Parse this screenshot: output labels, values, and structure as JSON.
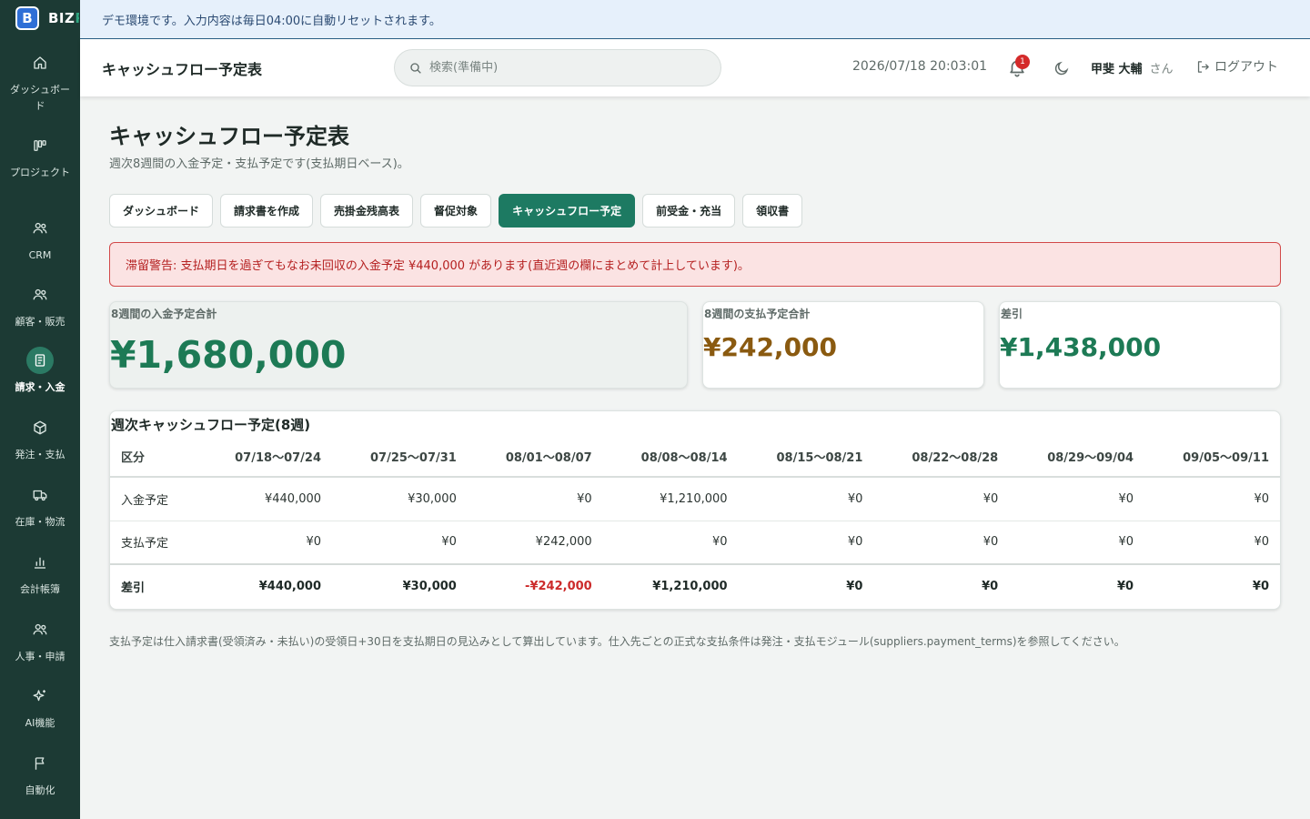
{
  "banner": {
    "text": "デモ環境です。入力内容は毎日04:00に自動リセットされます。"
  },
  "sidebar": {
    "logo_letter": "B",
    "logo_text": "BIZ",
    "logo_text_cut": "R",
    "items": [
      {
        "label": "ダッシュボード",
        "icon": "home-icon"
      },
      {
        "label": "プロジェクト",
        "icon": "kanban-icon"
      },
      {
        "label": "CRM",
        "icon": "users-icon"
      },
      {
        "label": "顧客・販売",
        "icon": "users-icon"
      },
      {
        "label": "請求・入金",
        "icon": "receipt-icon",
        "active": true
      },
      {
        "label": "発注・支払",
        "icon": "box-icon"
      },
      {
        "label": "在庫・物流",
        "icon": "truck-icon"
      },
      {
        "label": "会計帳簿",
        "icon": "chart-icon"
      },
      {
        "label": "人事・申請",
        "icon": "users-icon"
      },
      {
        "label": "AI機能",
        "icon": "sparkle-icon"
      },
      {
        "label": "自動化",
        "icon": "flag-icon"
      }
    ]
  },
  "header": {
    "title": "キャッシュフロー予定表",
    "search_placeholder": "検索(準備中)",
    "datetime": "2026/07/18 20:03:01",
    "notification_count": "1",
    "user_name": "甲斐 大輔",
    "user_suffix": "さん",
    "logout_label": "ログアウト"
  },
  "page": {
    "title": "キャッシュフロー予定表",
    "subtitle": "週次8週間の入金予定・支払予定です(支払期日ベース)。",
    "tabs": [
      "ダッシュボード",
      "請求書を作成",
      "売掛金残高表",
      "督促対象",
      "キャッシュフロー予定",
      "前受金・充当",
      "領収書"
    ],
    "active_tab": 4,
    "alert": "滞留警告: 支払期日を過ぎてもなお未回収の入金予定 ¥440,000 があります(直近週の欄にまとめて計上しています)。",
    "summary": {
      "income_label": "8週間の入金予定合計",
      "income_value": "¥1,680,000",
      "payment_label": "8週間の支払予定合計",
      "payment_value": "¥242,000",
      "diff_label": "差引",
      "diff_value": "¥1,438,000"
    },
    "table": {
      "title": "週次キャッシュフロー予定(8週)",
      "headers": [
        "区分",
        "07/18〜07/24",
        "07/25〜07/31",
        "08/01〜08/07",
        "08/08〜08/14",
        "08/15〜08/21",
        "08/22〜08/28",
        "08/29〜09/04",
        "09/05〜09/11"
      ],
      "rows": [
        [
          "入金予定",
          "¥440,000",
          "¥30,000",
          "¥0",
          "¥1,210,000",
          "¥0",
          "¥0",
          "¥0",
          "¥0"
        ],
        [
          "支払予定",
          "¥0",
          "¥0",
          "¥242,000",
          "¥0",
          "¥0",
          "¥0",
          "¥0",
          "¥0"
        ],
        [
          "差引",
          "¥440,000",
          "¥30,000",
          "-¥242,000",
          "¥1,210,000",
          "¥0",
          "¥0",
          "¥0",
          "¥0"
        ]
      ]
    },
    "footnote": "支払予定は仕入請求書(受領済み・未払い)の受領日+30日を支払期日の見込みとして算出しています。仕入先ごとの正式な支払条件は発注・支払モジュール(suppliers.payment_terms)を参照してください。"
  },
  "colors": {
    "sidebar_bg": "#1c3a34",
    "accent": "#1d7a62",
    "income": "#1d7a55",
    "payment": "#8a5a10",
    "negative": "#cc2b2b",
    "alert_bg": "#fbe3e3"
  }
}
